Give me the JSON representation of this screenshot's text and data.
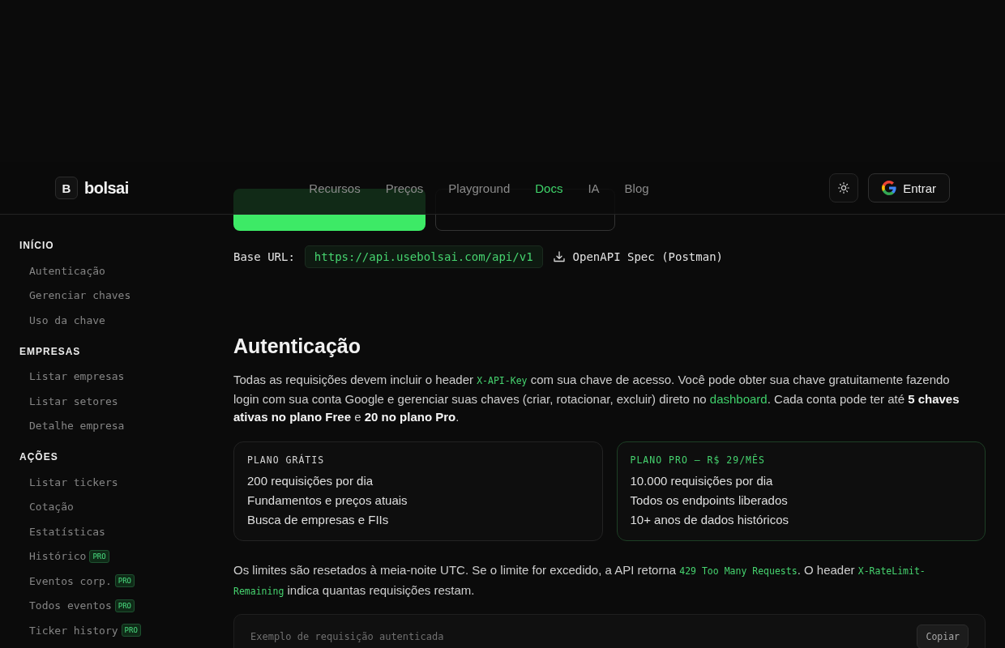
{
  "header": {
    "logo": {
      "mark": "B",
      "name": "bolsai"
    },
    "nav": [
      {
        "label": "Recursos",
        "selected": false
      },
      {
        "label": "Preços",
        "selected": false
      },
      {
        "label": "Playground",
        "selected": false
      },
      {
        "label": "Docs",
        "selected": true
      },
      {
        "label": "IA",
        "selected": false
      },
      {
        "label": "Blog",
        "selected": false
      }
    ],
    "login_button": "Entrar"
  },
  "sidebar": {
    "sections": [
      {
        "title": "INÍCIO",
        "items": [
          {
            "label": "Autenticação"
          },
          {
            "label": "Gerenciar chaves"
          },
          {
            "label": "Uso da chave"
          }
        ]
      },
      {
        "title": "EMPRESAS",
        "items": [
          {
            "label": "Listar empresas"
          },
          {
            "label": "Listar setores"
          },
          {
            "label": "Detalhe empresa"
          }
        ]
      },
      {
        "title": "AÇÕES",
        "items": [
          {
            "label": "Listar tickers"
          },
          {
            "label": "Cotação"
          },
          {
            "label": "Estatísticas"
          },
          {
            "label": "Histórico",
            "badge": "PRO"
          },
          {
            "label": "Eventos corp.",
            "badge": "PRO"
          },
          {
            "label": "Todos eventos",
            "badge": "PRO"
          },
          {
            "label": "Ticker history",
            "badge": "PRO"
          }
        ]
      }
    ]
  },
  "hero_buttons": [
    {
      "kind": "primary"
    },
    {
      "kind": "secondary"
    }
  ],
  "base_url": {
    "label": "Base URL:",
    "value": "https://api.usebolsai.com/api/v1",
    "spec_link": "OpenAPI Spec (Postman)"
  },
  "section": {
    "title": "Autenticação",
    "intro": [
      {
        "kind": "text",
        "text": "Todas as requisições devem incluir o header "
      },
      {
        "kind": "code",
        "text": "X-API-Key"
      },
      {
        "kind": "text",
        "text": " com sua chave de acesso. Você pode obter sua chave gratuitamente fazendo login com sua conta Google e gerenciar suas chaves (criar, rotacionar, excluir) direto no "
      },
      {
        "kind": "link",
        "text": "dashboard"
      },
      {
        "kind": "text",
        "text": ". Cada conta pode ter até "
      },
      {
        "kind": "strong",
        "text": "5 chaves ativas no plano Free"
      },
      {
        "kind": "text",
        "text": " e "
      },
      {
        "kind": "strong",
        "text": "20 no plano Pro"
      },
      {
        "kind": "text",
        "text": "."
      }
    ],
    "plans": [
      {
        "title": "PLANO GRÁTIS",
        "kind": "free",
        "features": [
          "200 requisições por dia",
          "Fundamentos e preços atuais",
          "Busca de empresas e FIIs"
        ]
      },
      {
        "title": "PLANO PRO — R$ 29/MÊS",
        "kind": "pro",
        "features": [
          "10.000 requisições por dia",
          "Todos os endpoints liberados",
          "10+ anos de dados históricos"
        ]
      }
    ],
    "limits_note": [
      {
        "kind": "text",
        "text": "Os limites são resetados à meia-noite UTC. Se o limite for excedido, a API retorna "
      },
      {
        "kind": "code",
        "text": "429 Too Many Requests"
      },
      {
        "kind": "text",
        "text": ". O header "
      },
      {
        "kind": "code",
        "text": "X-RateLimit-Remaining"
      },
      {
        "kind": "text",
        "text": " indica quantas requisições restam."
      }
    ],
    "code_example": {
      "title": "Exemplo de requisição autenticada",
      "copy_button": "Copiar"
    }
  }
}
